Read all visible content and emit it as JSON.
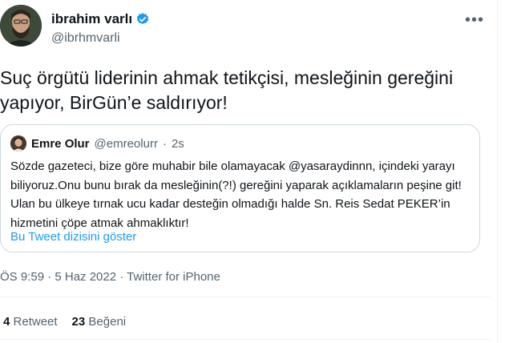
{
  "author": {
    "display_name": "ibrahim varlı",
    "handle": "@ibrhmvarli",
    "verified_color": "#1d9bf0"
  },
  "more_icon": "•••",
  "tweet": {
    "text": "Suç örgütü liderinin ahmak tetikçisi, mesleğinin gereğini yapıyor, BirGün’e saldırıyor!"
  },
  "quote": {
    "display_name": "Emre Olur",
    "handle": "@emreolurr",
    "separator": "·",
    "time": "2s",
    "text": "Sözde gazeteci, bize göre muhabir bile olamayacak @yasaraydinnn, içindeki yarayı biliyoruz.Onu bunu bırak da mesleğinin(?!) gereğini yaparak açıklamaların peşine git! Ulan bu ülkeye tırnak ucu kadar desteğin olmadığı halde Sn. Reis Sedat PEKER’in hizmetini çöpe atmak ahmaklıktır!",
    "show_thread": "Bu Tweet dizisini göster"
  },
  "meta": "ÖS 9:59 · 5 Haz 2022 · Twitter for iPhone",
  "stats": {
    "retweets_count": "4",
    "retweets_label": "Retweet",
    "likes_count": "23",
    "likes_label": "Beğeni"
  }
}
